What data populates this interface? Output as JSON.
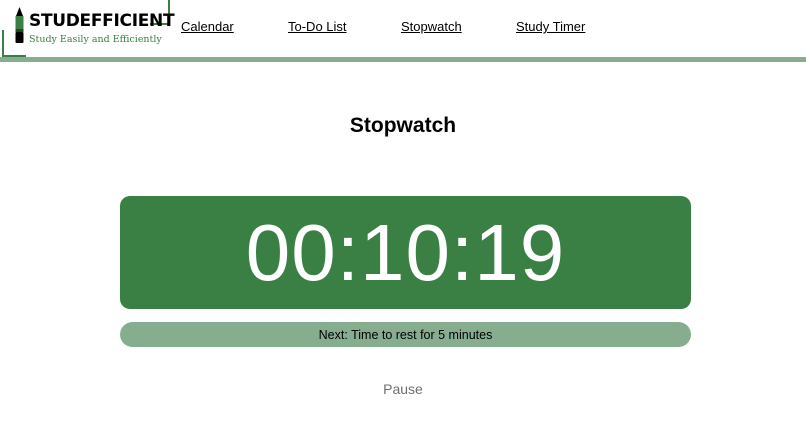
{
  "brand": {
    "title": "STUDEFFICIENT",
    "tagline": "Study Easily and Efficiently",
    "icon": "pencil-icon",
    "accent_color": "#3a8045",
    "secondary_color": "#86ad8e"
  },
  "nav": {
    "items": [
      {
        "label": "Calendar"
      },
      {
        "label": "To-Do List"
      },
      {
        "label": "Stopwatch"
      },
      {
        "label": "Study Timer"
      }
    ]
  },
  "main": {
    "title": "Stopwatch",
    "timer": "00:10:19",
    "next_message": "Next: Time to rest for 5 minutes",
    "pause_label": "Pause"
  }
}
